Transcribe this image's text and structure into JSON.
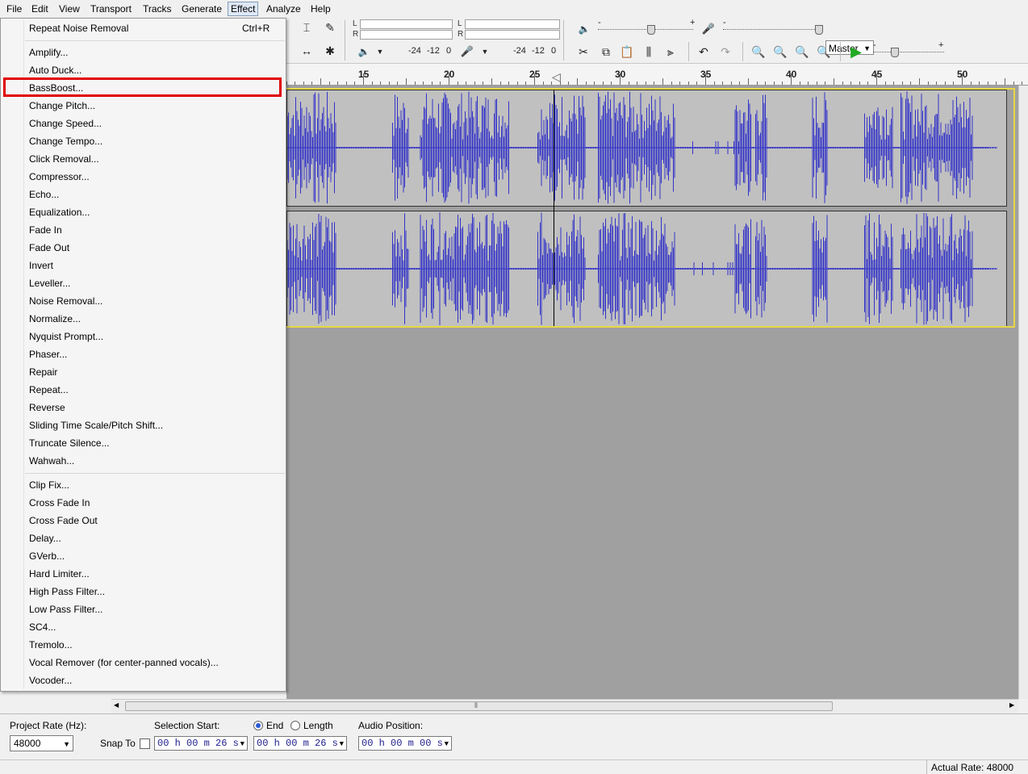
{
  "menubar": {
    "items": [
      "File",
      "Edit",
      "View",
      "Transport",
      "Tracks",
      "Generate",
      "Effect",
      "Analyze",
      "Help"
    ],
    "active": "Effect"
  },
  "effect_menu": {
    "repeat": {
      "label": "Repeat Noise Removal",
      "shortcut": "Ctrl+R"
    },
    "group1": [
      "Amplify...",
      "Auto Duck...",
      "BassBoost...",
      "Change Pitch...",
      "Change Speed...",
      "Change Tempo...",
      "Click Removal...",
      "Compressor...",
      "Echo...",
      "Equalization...",
      "Fade In",
      "Fade Out",
      "Invert",
      "Leveller...",
      "Noise Removal...",
      "Normalize...",
      "Nyquist Prompt...",
      "Phaser...",
      "Repair",
      "Repeat...",
      "Reverse",
      "Sliding Time Scale/Pitch Shift...",
      "Truncate Silence...",
      "Wahwah..."
    ],
    "group2": [
      "Clip Fix...",
      "Cross Fade In",
      "Cross Fade Out",
      "Delay...",
      "GVerb...",
      "Hard Limiter...",
      "High Pass Filter...",
      "Low Pass Filter...",
      "SC4...",
      "Tremolo...",
      "Vocal Remover (for center-panned vocals)...",
      "Vocoder..."
    ],
    "highlighted": "BassBoost..."
  },
  "toolbar": {
    "meter_left": "L",
    "meter_right": "R",
    "meter_scale_play": [
      "-24",
      "-12",
      "0"
    ],
    "meter_scale_rec": [
      "-24",
      "-12",
      "0"
    ],
    "mixer_source": "Master",
    "slider_minus": "-",
    "slider_plus": "+"
  },
  "ruler": {
    "labels": [
      "15",
      "20",
      "25",
      "30",
      "35",
      "40",
      "45",
      "50"
    ]
  },
  "bottom": {
    "project_rate_label": "Project Rate (Hz):",
    "project_rate": "48000",
    "snap_to_label": "Snap To",
    "selection_start_label": "Selection Start:",
    "end_label": "End",
    "length_label": "Length",
    "selection_start": "00 h 00 m 26 s",
    "selection_end": "00 h 00 m 26 s",
    "audio_position_label": "Audio Position:",
    "audio_position": "00 h 00 m 00 s"
  },
  "status": {
    "actual_rate": "Actual Rate: 48000"
  },
  "colors": {
    "waveform": "#3232c8",
    "highlight_box": "#e00000",
    "track_bg": "#c0c0c0",
    "workspace_bg": "#a0a0a0"
  }
}
